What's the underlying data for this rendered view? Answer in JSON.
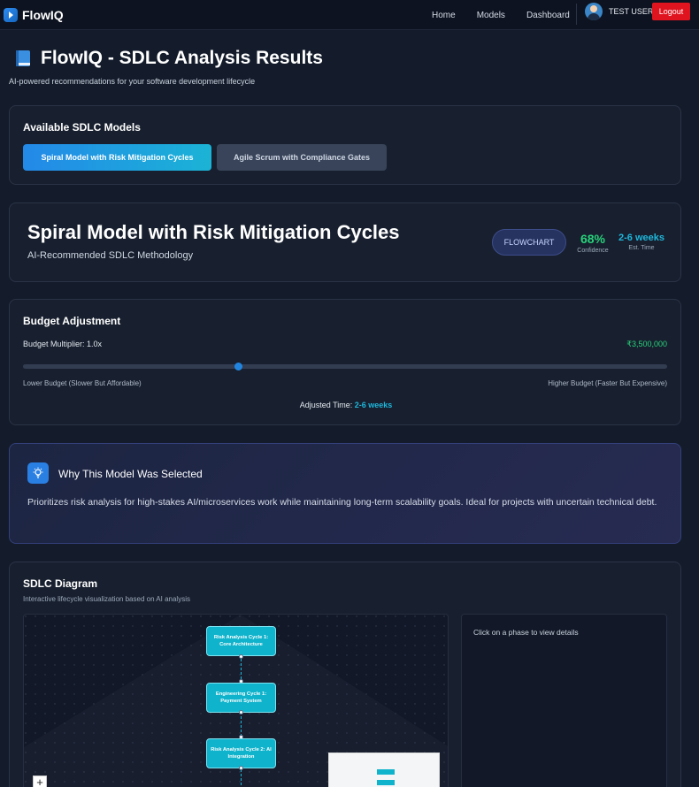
{
  "nav": {
    "brand": "FlowIQ",
    "links": [
      "Home",
      "Models",
      "Dashboard"
    ],
    "user": "TEST USER",
    "logout": "Logout"
  },
  "header": {
    "title": "FlowIQ - SDLC Analysis Results",
    "subtitle": "AI-powered recommendations for your software development lifecycle"
  },
  "models": {
    "heading": "Available SDLC Models",
    "options": [
      "Spiral Model with Risk Mitigation Cycles",
      "Agile Scrum with Compliance Gates"
    ],
    "selected_index": 0
  },
  "recommended": {
    "name": "Spiral Model with Risk Mitigation Cycles",
    "tagline": "AI-Recommended SDLC Methodology",
    "flowchart_label": "FLOWCHART",
    "confidence_value": "68%",
    "confidence_label": "Confidence",
    "time_value": "2-6 weeks",
    "time_label": "Est. Time"
  },
  "budget": {
    "heading": "Budget Adjustment",
    "multiplier_label": "Budget Multiplier: 1.0x",
    "amount": "₹3,500,000",
    "slider_fraction": 0.335,
    "low_label": "Lower Budget (Slower But Affordable)",
    "high_label": "Higher Budget (Faster But Expensive)",
    "adjusted_prefix": "Adjusted Time:",
    "adjusted_value": "2-6 weeks"
  },
  "why": {
    "title": "Why This Model Was Selected",
    "text": "Prioritizes risk analysis for high-stakes AI/microservices work while maintaining long-term scalability goals. Ideal for projects with uncertain technical debt."
  },
  "diagram": {
    "heading": "SDLC Diagram",
    "subtitle": "Interactive lifecycle visualization based on AI analysis",
    "phases": [
      "Risk Analysis Cycle 1: Core Architecture",
      "Engineering Cycle 1: Payment System",
      "Risk Analysis Cycle 2: AI Integration"
    ],
    "zoom_in": "+",
    "details_hint": "Click on a phase to view details"
  }
}
